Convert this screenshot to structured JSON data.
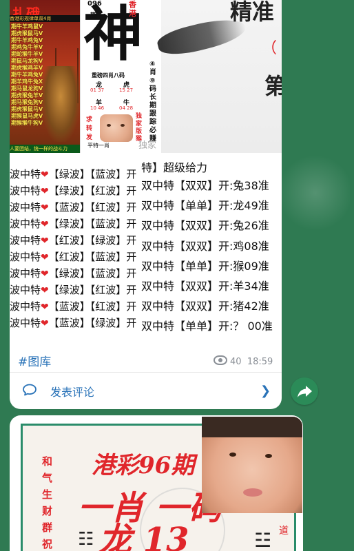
{
  "message1": {
    "image": {
      "left_panel": {
        "logo": "扎硪",
        "header": "香港彩规律单双4肖",
        "rows": [
          "期牛羊鸡鼠V",
          "期虎猴鼠马V",
          "期牛羊鸡兔V",
          "期鸡兔牛羊V",
          "期蛇猴牛羊V",
          "期鼠马龙狗V",
          "期虎猴鸡羊V",
          "期牛羊鸡兔V",
          "期羊鸡牛兔X",
          "期马鼠龙狗V",
          "期虎猴兔羊V",
          "期马猴兔狗V",
          "期虎猴鼠马V",
          "期猴鼠马虎V",
          "期猴猴牛狗V"
        ],
        "footer": "人要团结，统一样的战斗力"
      },
      "mid_panel": {
        "issue_no": "096",
        "issue_unit": "期",
        "hk_label": "香港",
        "big_char": "神",
        "subtitle": "重磅四肖八码",
        "side_text": "④肖⑧码长期跟踪必赚",
        "pair1": {
          "a": "龙",
          "b": "虎",
          "na": "01 37",
          "nb": "15 27"
        },
        "pair2": {
          "a": "羊",
          "b": "牛",
          "na": "10 46",
          "nb": "04 28"
        },
        "red_left": "求转发",
        "red_right": "独家版猴",
        "footer": "平特一肖",
        "watermark": "独家"
      },
      "right_panel": {
        "title": "精准",
        "paren": "（",
        "di": "第"
      }
    },
    "rows_left": [
      {
        "text": "波中特",
        "a": "【绿波】",
        "b": "【蓝波】",
        "c": "开"
      },
      {
        "text": "波中特",
        "a": "【绿波】",
        "b": "【红波】",
        "c": "开"
      },
      {
        "text": "波中特",
        "a": "【蓝波】",
        "b": "【红波】",
        "c": "开"
      },
      {
        "text": "波中特",
        "a": "【绿波】",
        "b": "【蓝波】",
        "c": "开"
      },
      {
        "text": "波中特",
        "a": "【红波】",
        "b": "【绿波】",
        "c": "开"
      },
      {
        "text": "波中特",
        "a": "【红波】",
        "b": "【蓝波】",
        "c": "开"
      },
      {
        "text": "波中特",
        "a": "【绿波】",
        "b": "【蓝波】",
        "c": "开"
      },
      {
        "text": "波中特",
        "a": "【绿波】",
        "b": "【红波】",
        "c": "开"
      },
      {
        "text": "波中特",
        "a": "【蓝波】",
        "b": "【红波】",
        "c": "开"
      },
      {
        "text": "波中特",
        "a": "【蓝波】",
        "b": "【绿波】",
        "c": "开"
      }
    ],
    "rows_right": [
      "特】超级给力",
      "双中特【双双】开:兔38准",
      "双中特【单单】开:龙49准",
      "双中特【双双】开:兔26准",
      "双中特【双双】开:鸡08准",
      "双中特【单单】开:猴09准",
      "双中特【双双】开:羊34准",
      "双中特【双双】开:猪42准",
      "双中特【单单】开:？ 00准"
    ],
    "hashtag": "#图库",
    "views": "40",
    "time": "18:59",
    "comment_label": "发表评论"
  },
  "message2": {
    "vertical_text": "和气生财群祝",
    "line1": "港彩96期",
    "line2": "一肖 一码",
    "line3": "龙  13",
    "dot_text": "道",
    "marks_left": "☷",
    "marks_right": "☳"
  }
}
